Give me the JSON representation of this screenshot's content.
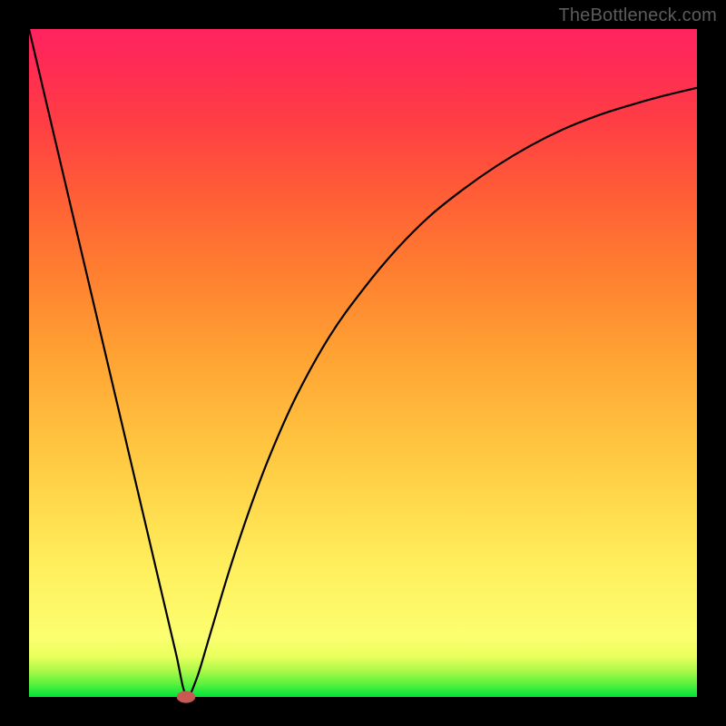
{
  "watermark": "TheBottleneck.com",
  "chart_data": {
    "type": "line",
    "title": "",
    "xlabel": "",
    "ylabel": "",
    "x_range": [
      0,
      100
    ],
    "y_range": [
      0,
      100
    ],
    "series": [
      {
        "name": "curve",
        "x": [
          0,
          2,
          4,
          6,
          8,
          10,
          12,
          14,
          16,
          18,
          20,
          22,
          23.5,
          25,
          27,
          30,
          33,
          36,
          40,
          45,
          50,
          55,
          60,
          65,
          70,
          75,
          80,
          85,
          90,
          95,
          100
        ],
        "y": [
          100,
          91.5,
          83,
          74.5,
          66,
          57.5,
          49,
          40.5,
          32,
          23.5,
          15,
          6.5,
          0.3,
          2.5,
          9,
          19,
          28,
          36,
          45,
          54,
          61,
          67,
          72,
          76,
          79.5,
          82.5,
          85,
          87,
          88.6,
          90,
          91.2
        ]
      }
    ],
    "marker": {
      "x": 23.5,
      "y": 0.0,
      "rx": 1.4,
      "ry": 0.9,
      "color": "#c85a54"
    },
    "gradient_stops": [
      {
        "pos": 0,
        "color": "#00e43a"
      },
      {
        "pos": 9,
        "color": "#fcff70"
      },
      {
        "pos": 50,
        "color": "#ffa033"
      },
      {
        "pos": 100,
        "color": "#ff2460"
      }
    ]
  }
}
